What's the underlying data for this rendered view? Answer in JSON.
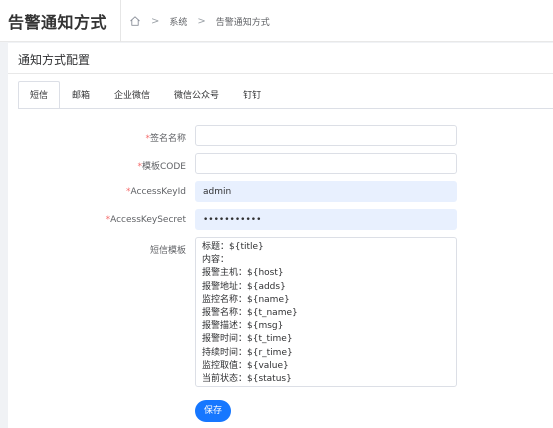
{
  "header": {
    "title": "告警通知方式",
    "breadcrumb": [
      "系统",
      "告警通知方式"
    ]
  },
  "card": {
    "title": "通知方式配置"
  },
  "tabs": [
    {
      "label": "短信",
      "active": true
    },
    {
      "label": "邮箱",
      "active": false
    },
    {
      "label": "企业微信",
      "active": false
    },
    {
      "label": "微信公众号",
      "active": false
    },
    {
      "label": "钉钉",
      "active": false
    }
  ],
  "form": {
    "sign_name": {
      "label": "签名名称",
      "required": true,
      "value": ""
    },
    "template_code": {
      "label": "模板CODE",
      "required": true,
      "value": ""
    },
    "access_key_id": {
      "label": "AccessKeyId",
      "required": true,
      "value": "admin"
    },
    "access_key_secret": {
      "label": "AccessKeySecret",
      "required": true,
      "value": "•••••••••••"
    },
    "sms_template": {
      "label": "短信模板",
      "required": false,
      "value": "标题：${title}\n内容：\n报警主机：${host}\n报警地址：${adds}\n监控名称：${name}\n报警名称：${t_name}\n报警描述：${msg}\n报警时间：${t_time}\n持续时间：${r_time}\n监控取值：${value}\n当前状态：${status}"
    },
    "required_mark": "*"
  },
  "actions": {
    "save_label": "保存"
  },
  "colors": {
    "primary": "#1677ff",
    "required": "#f56c6c",
    "autofill_bg": "#e8f0fe"
  }
}
